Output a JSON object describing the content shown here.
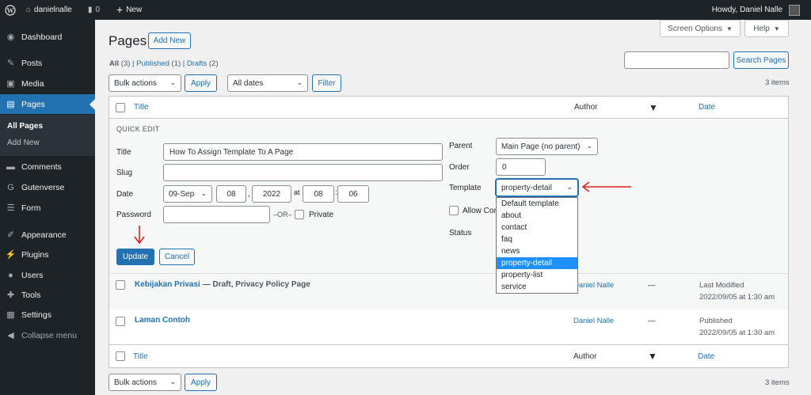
{
  "admin_bar": {
    "site_name": "danielnalle",
    "comments_count": "0",
    "new_label": "New",
    "greeting": "Howdy, Daniel Nalle"
  },
  "sidebar": {
    "items": [
      {
        "label": "Dashboard",
        "icon": "dashboard-icon"
      },
      {
        "label": "Posts",
        "icon": "pin-icon"
      },
      {
        "label": "Media",
        "icon": "media-icon"
      },
      {
        "label": "Pages",
        "icon": "pages-icon"
      },
      {
        "label": "Comments",
        "icon": "comment-icon"
      },
      {
        "label": "Gutenverse",
        "icon": "gutenverse-icon"
      },
      {
        "label": "Form",
        "icon": "form-icon"
      },
      {
        "label": "Appearance",
        "icon": "brush-icon"
      },
      {
        "label": "Plugins",
        "icon": "plugin-icon"
      },
      {
        "label": "Users",
        "icon": "users-icon"
      },
      {
        "label": "Tools",
        "icon": "wrench-icon"
      },
      {
        "label": "Settings",
        "icon": "settings-icon"
      }
    ],
    "submenu": {
      "all_pages": "All Pages",
      "add_new": "Add New"
    },
    "collapse": "Collapse menu"
  },
  "header": {
    "title": "Pages",
    "add_new": "Add New",
    "screen_options": "Screen Options",
    "help": "Help"
  },
  "filters": {
    "all": "All",
    "all_count": "(3)",
    "published": "Published",
    "published_count": "(1)",
    "drafts": "Drafts",
    "drafts_count": "(2)",
    "bulk_actions": "Bulk actions",
    "apply": "Apply",
    "all_dates": "All dates",
    "filter": "Filter",
    "search_button": "Search Pages",
    "items_count": "3 items"
  },
  "table": {
    "col_title": "Title",
    "col_author": "Author",
    "col_date": "Date"
  },
  "quick_edit": {
    "heading": "QUICK EDIT",
    "title_label": "Title",
    "title_value": "How To Assign Template To A Page",
    "slug_label": "Slug",
    "slug_value": "",
    "date_label": "Date",
    "month": "09-Sep",
    "day": "08",
    "year": "2022",
    "at": "at",
    "hour": "08",
    "colon": ":",
    "minute": "06",
    "comma": ",",
    "password_label": "Password",
    "or_label": "–OR–",
    "private_label": "Private",
    "parent_label": "Parent",
    "parent_value": "Main Page (no parent)",
    "order_label": "Order",
    "order_value": "0",
    "template_label": "Template",
    "template_value": "property-detail",
    "allow_comments": "Allow Com",
    "status_label": "Status",
    "update": "Update",
    "cancel": "Cancel",
    "template_options": [
      "Default template",
      "about",
      "contact",
      "faq",
      "news",
      "property-detail",
      "property-list",
      "service"
    ],
    "selected_option": "property-detail"
  },
  "rows": [
    {
      "title": "Kebijakan Privasi",
      "state": " — Draft, Privacy Policy Page",
      "author": "Daniel Nalle",
      "comments": "—",
      "date_status": "Last Modified",
      "date": "2022/09/05 at 1:30 am"
    },
    {
      "title": "Laman Contoh",
      "state": "",
      "author": "Daniel Nalle",
      "comments": "—",
      "date_status": "Published",
      "date": "2022/09/05 at 1:30 am"
    }
  ],
  "footer_bar": {
    "bulk_actions": "Bulk actions",
    "apply": "Apply",
    "items_count": "3 items"
  },
  "colors": {
    "accent": "#2271b1",
    "sidebar": "#1d2327",
    "annotation": "#e0201c"
  }
}
